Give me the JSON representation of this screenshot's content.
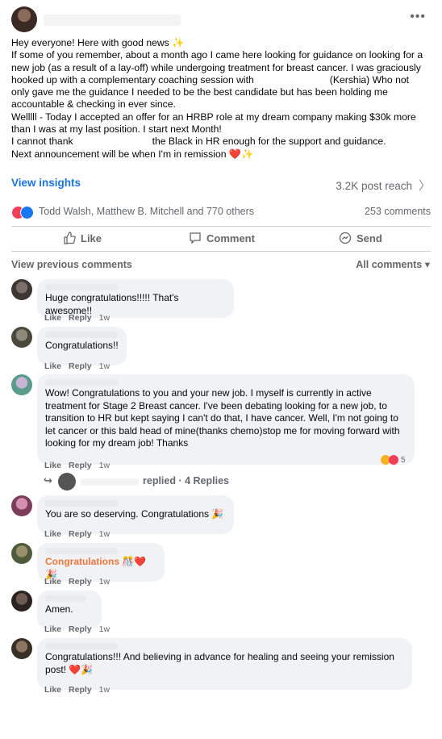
{
  "post": {
    "more_icon": "more-horizontal-icon",
    "lines": [
      "Hey everyone! Here with good news ✨",
      "If some of you remember, about a month ago I came here looking for guidance on looking for a",
      "new job (as a result of a lay-off) while undergoing treatment for breast cancer. I was graciously",
      "hooked up with a complementary coaching session with",
      "(Kershia) Who not",
      "only gave me the guidance I needed to be the best candidate but has been holding me",
      "accountable & checking in ever since.",
      "Welllll - Today I accepted an offer for an HRBP role at my dream company making $30k more",
      "than I was at my last position. I start next Month!",
      "I cannot thank",
      "the Black in HR enough for the support and guidance.",
      "Next announcement will be when I'm in remission ❤️✨"
    ],
    "view_insights": "View insights",
    "post_reach": "3.2K post reach",
    "reaction_names": "Todd Walsh, Matthew B. Mitchell and 770 others",
    "comments_count": "253 comments",
    "actions": {
      "like": "Like",
      "comment": "Comment",
      "send": "Send"
    },
    "view_previous": "View previous comments",
    "all_comments": "All comments ▾"
  },
  "meta_labels": {
    "like": "Like",
    "reply": "Reply"
  },
  "comments": [
    {
      "text": "Huge congratulations!!!!! That's awesome!!",
      "time": "1w"
    },
    {
      "text": "Congratulations!!",
      "time": "1w"
    },
    {
      "text": "Wow! Congratulations to you and your new job. I myself is currently in active treatment for Stage 2 Breast cancer. I've been debating looking for a new job, to transition to HR but kept saying I can't do that, I have cancer. Well, I'm not going to let cancer or this bald head of mine(thanks chemo)stop me for moving forward with looking for my dream job! Thanks",
      "time": "1w",
      "reaction_count": "5"
    },
    {
      "text": "You are so deserving. Congratulations 🎉",
      "time": "1w"
    },
    {
      "text": "Congratulations 🎊❤️🎉",
      "time": "1w"
    },
    {
      "text": "Amen.",
      "time": "1w"
    },
    {
      "text": "Congratulations!!! And believing in advance for healing and seeing your remission post! ❤️🎉",
      "time": "1w"
    }
  ],
  "replied": {
    "text": "replied · 4 Replies"
  },
  "colors": {
    "link": "#1b74e4",
    "muted": "#65676b",
    "bubble": "#f0f2f5",
    "love": "#f33e58",
    "like": "#1877f2",
    "highlight": "#f0763c"
  }
}
